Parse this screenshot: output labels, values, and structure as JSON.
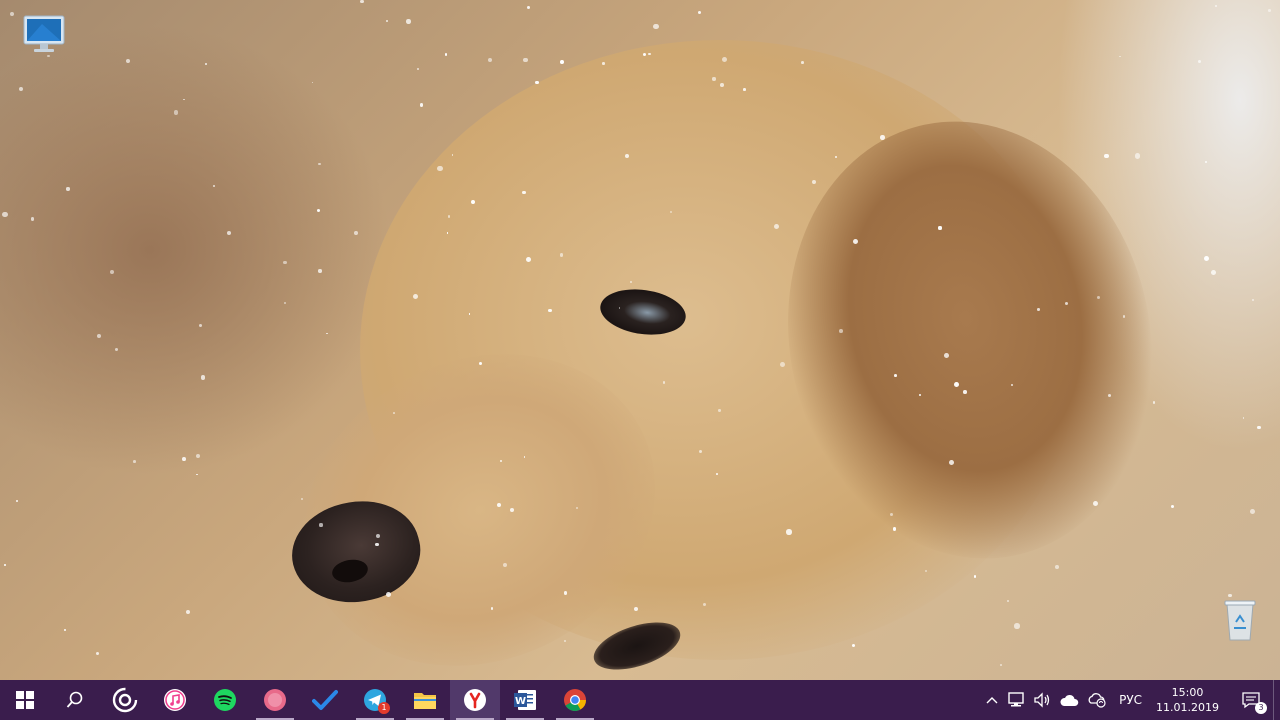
{
  "desktop": {
    "wallpaper": "golden retriever in snow",
    "icons": [
      {
        "name": "computer-icon"
      },
      {
        "name": "recycle-bin-icon"
      }
    ]
  },
  "taskbar": {
    "background": "#3a1d4d",
    "apps": [
      {
        "name": "start-button",
        "icon": "windows-logo-icon"
      },
      {
        "name": "search-button",
        "icon": "search-icon"
      },
      {
        "name": "cortana-button",
        "icon": "cortana-icon"
      },
      {
        "name": "itunes-button",
        "icon": "itunes-icon"
      },
      {
        "name": "spotify-button",
        "icon": "spotify-icon"
      },
      {
        "name": "app-button",
        "icon": "pink-circle-icon"
      },
      {
        "name": "wunderlist-button",
        "icon": "checkmark-icon"
      },
      {
        "name": "telegram-button",
        "icon": "telegram-icon",
        "badge": "1"
      },
      {
        "name": "file-explorer-button",
        "icon": "folder-icon"
      },
      {
        "name": "yandex-browser-button",
        "icon": "yandex-icon"
      },
      {
        "name": "word-button",
        "icon": "word-icon",
        "letter": "W"
      },
      {
        "name": "chrome-button",
        "icon": "chrome-icon"
      }
    ],
    "tray": {
      "language": "РУС",
      "time": "15:00",
      "date": "11.01.2019",
      "notification_count": "3"
    }
  }
}
